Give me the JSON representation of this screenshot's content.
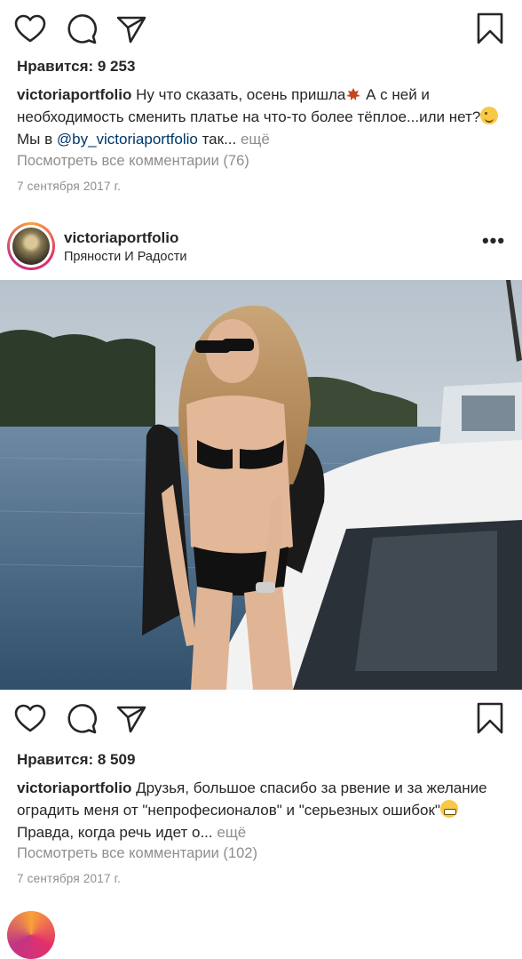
{
  "post1": {
    "likes": "Нравится: 9 253",
    "caption_user": "victoriaportfolio",
    "caption_part1": " Ну что сказать, осень пришла",
    "caption_part2": " А с ней и необходимость сменить платье на что-то более тёплое...или нет?",
    "caption_part3": " Мы в ",
    "caption_mention": "@by_victoriaportfolio",
    "caption_part4": " так...",
    "caption_more": " ещё",
    "comments": "Посмотреть все комментарии (76)",
    "date": "7 сентября 2017 г."
  },
  "post2": {
    "username": "victoriaportfolio",
    "location": "Пряности И Радости",
    "more_icon": "•••",
    "likes": "Нравится: 8 509",
    "caption_user": "victoriaportfolio",
    "caption_part1": " Друзья, большое спасибо за рвение и за желание оградить меня от \"непрофесионалов\" и \"серьезных ошибок\"",
    "caption_part2": " Правда, когда речь идет о...",
    "caption_more": " ещё",
    "comments": "Посмотреть все комментарии (102)",
    "date": "7 сентября 2017 г."
  },
  "icons": [
    "heart-icon",
    "comment-icon",
    "share-icon",
    "bookmark-icon",
    "more-icon",
    "maple-leaf-emoji",
    "wink-emoji",
    "grin-emoji"
  ]
}
